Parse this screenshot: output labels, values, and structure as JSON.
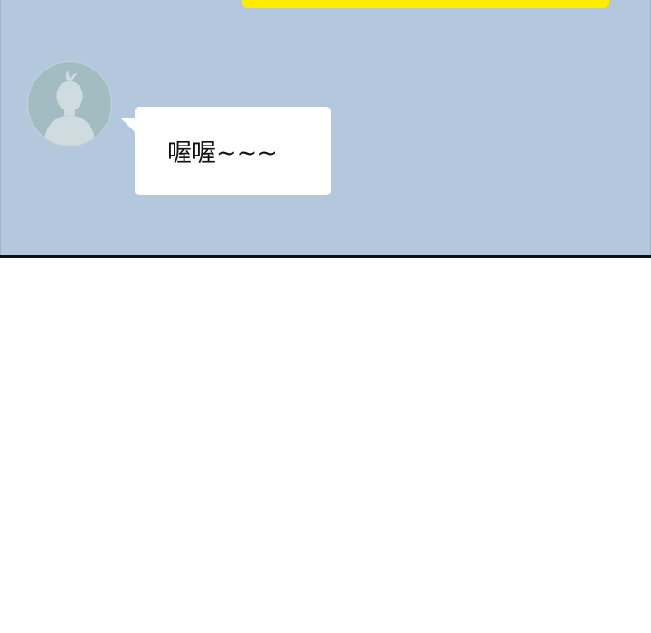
{
  "chat": {
    "received_message": {
      "text": "喔喔~~~"
    },
    "avatar": {
      "icon": "default-person-icon"
    }
  },
  "colors": {
    "chat_background": "#b3c8dd",
    "sent_bubble": "#ffec00",
    "received_bubble": "#ffffff",
    "avatar_background": "#a3bcc2"
  }
}
